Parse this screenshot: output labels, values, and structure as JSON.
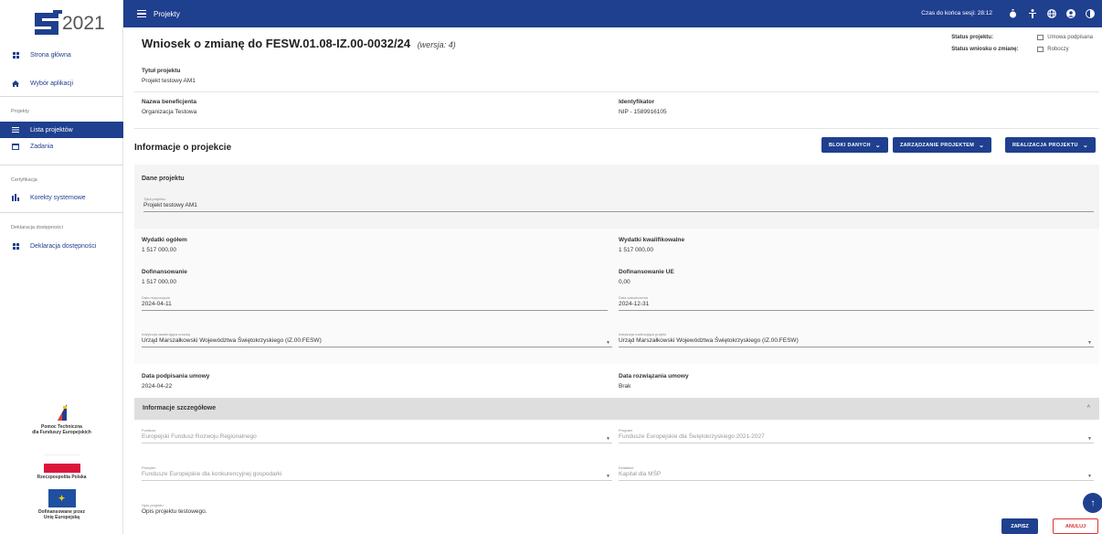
{
  "topbar": {
    "title": "Projekty",
    "session_label": "Czas do końca sesji:",
    "session_time": "28:12",
    "icons": [
      "timer-icon",
      "accessibility-icon",
      "language-icon",
      "user-icon",
      "contrast-icon"
    ]
  },
  "sidebar": {
    "logo_text": "2021",
    "items": [
      {
        "label": "Strona główna",
        "icon": "dashboard-icon",
        "active": false
      },
      {
        "label": "Wybór aplikacji",
        "icon": "home-icon",
        "active": false
      }
    ],
    "section_projects": "Projekty",
    "project_items": [
      {
        "label": "Lista projektów",
        "icon": "list-icon",
        "active": true
      },
      {
        "label": "Zadania",
        "icon": "calendar-icon",
        "active": false
      }
    ],
    "section_cert": "Certyfikacja",
    "cert_items": [
      {
        "label": "Korekty systemowe",
        "icon": "chart-icon",
        "active": false
      }
    ],
    "section_access": "Deklaracja dostępności",
    "access_items": [
      {
        "label": "Deklaracja dostępności",
        "icon": "dashboard-icon",
        "active": false
      }
    ],
    "footer": {
      "pt_line1": "Pomoc Techniczna",
      "pt_line2": "dla Funduszy Europejskich",
      "rp": "Rzeczpospolita Polska",
      "eu_line1": "Dofinansowane przez",
      "eu_line2": "Unię Europejską"
    }
  },
  "header": {
    "title": "Wniosek o zmianę do FESW.01.08-IZ.00-0032/24",
    "version": "(wersja: 4)",
    "status_project_label": "Status projektu:",
    "status_project_value": "Umowa podpisana",
    "status_request_label": "Status wniosku o zmianę:",
    "status_request_value": "Roboczy"
  },
  "basic": {
    "project_title_label": "Tytuł projektu",
    "project_title_value": "Projekt testowy AM1",
    "beneficiary_label": "Nazwa beneficjenta",
    "beneficiary_value": "Organizacja Testowa",
    "identifier_label": "Identyfikator",
    "identifier_value": "NIP - 1589916105"
  },
  "project_info": {
    "title": "Informacje o projekcie",
    "buttons": [
      "BLOKI DANYCH",
      "ZARZĄDZANIE PROJEKTEM",
      "REALIZACJA PROJEKTU"
    ]
  },
  "details": {
    "section": "Dane projektu",
    "title_field_label": "Tytuł projektu",
    "title_field_value": "Projekt testowy AM1",
    "total_label": "Wydatki ogółem",
    "total_value": "1 517 000,00",
    "eligible_label": "Wydatki kwalifikowalne",
    "eligible_value": "1 517 000,00",
    "cofin_label": "Dofinansowanie",
    "cofin_value": "1 517 000,00",
    "cofin_eu_label": "Dofinansowanie UE",
    "cofin_eu_value": "0,00",
    "start_label": "Data rozpoczęcia",
    "start_value": "2024-04-11",
    "end_label": "Data zakończenia",
    "end_value": "2024-12-31",
    "inst_contract_label": "Instytucja zawierająca umowę",
    "inst_contract_value": "Urząd Marszałkowski Województwa Świętokrzyskiego (IZ.00.FESW)",
    "inst_settle_label": "Instytucja rozliczająca projekt",
    "inst_settle_value": "Urząd Marszałkowski Województwa Świętokrzyskiego (IZ.00.FESW)",
    "sign_label": "Data podpisania umowy",
    "sign_value": "2024-04-22",
    "termination_label": "Data rozwiązania umowy",
    "termination_value": "Brak"
  },
  "detailed": {
    "title": "Informacje szczegółowe",
    "fund_label": "Fundusz",
    "fund_value": "Europejski Fundusz Rozwoju Regionalnego",
    "program_label": "Program",
    "program_value": "Fundusze Europejskie dla Świętokrzyskiego 2021-2027",
    "priority_label": "Priorytet",
    "priority_value": "Fundusze Europejskie dla konkurencyjnej gospodarki",
    "action_label": "Działanie",
    "action_value": "Kapitał dla MŚP",
    "desc_label": "Opis projektu",
    "desc_value": "Opis projektu testowego."
  },
  "actions": {
    "save": "ZAPISZ",
    "cancel": "ANULUJ"
  },
  "colors": {
    "brand": "#1f3f8f",
    "danger": "#d33333"
  }
}
